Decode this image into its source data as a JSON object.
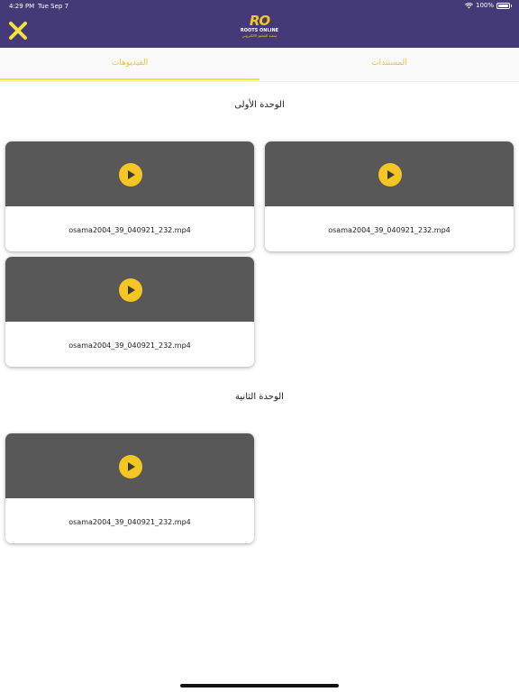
{
  "status_bar": {
    "time": "4:29 PM",
    "date": "Tue Sep 7",
    "battery": "100%"
  },
  "header": {
    "logo_mark": "RO",
    "logo_text": "ROOTS ONLINE",
    "logo_subtitle": "منصة التعليم الالكتروني"
  },
  "tabs": {
    "videos": "الفيديوهات",
    "documents": "المستندات"
  },
  "sections": [
    {
      "title": "الوحدة الأولى",
      "videos": [
        {
          "filename": "osama2004_39_040921_232.mp4"
        },
        {
          "filename": "osama2004_39_040921_232.mp4"
        },
        {
          "filename": "osama2004_39_040921_232.mp4"
        }
      ]
    },
    {
      "title": "الوحدة الثانية",
      "videos": [
        {
          "filename": "osama2004_39_040921_232.mp4"
        }
      ]
    }
  ],
  "colors": {
    "header_bg": "#453a78",
    "accent": "#f5c623",
    "thumb_bg": "#585858"
  },
  "icons": {
    "close": "close-icon",
    "play": "play-icon",
    "wifi": "wifi-icon",
    "battery": "battery-icon"
  }
}
